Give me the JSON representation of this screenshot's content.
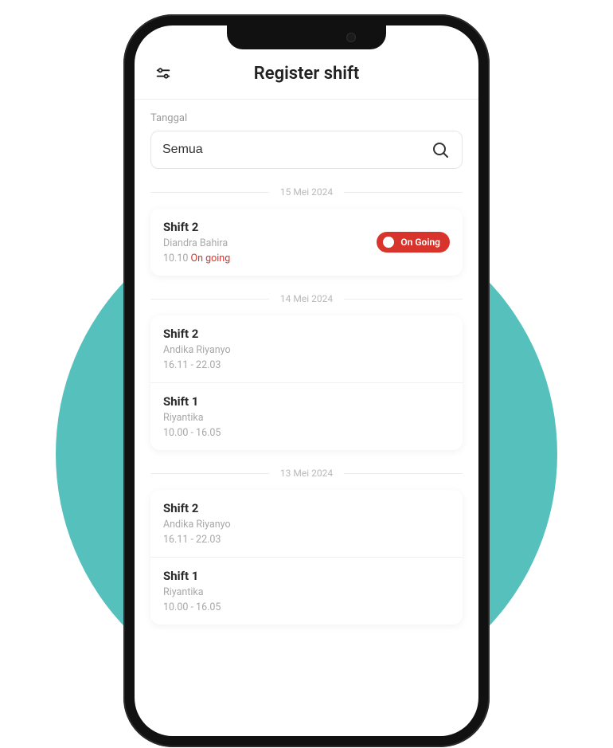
{
  "colors": {
    "accent_teal": "#55c0bc",
    "danger": "#d9342b"
  },
  "header": {
    "title": "Register shift",
    "filter_icon": "filter-icon"
  },
  "filter": {
    "label": "Tanggal",
    "value": "Semua",
    "search_icon": "search-icon"
  },
  "groups": [
    {
      "date_label": "15 Mei 2024",
      "shifts": [
        {
          "name": "Shift 2",
          "person": "Diandra Bahira",
          "time_prefix": "10.10 ",
          "ongoing_text": "On going",
          "badge_label": "On Going",
          "ongoing": true
        }
      ]
    },
    {
      "date_label": "14 Mei 2024",
      "shifts": [
        {
          "name": "Shift 2",
          "person": "Andika Riyanyo",
          "time": "16.11 - 22.03"
        },
        {
          "name": "Shift 1",
          "person": "Riyantika",
          "time": "10.00 - 16.05"
        }
      ]
    },
    {
      "date_label": "13 Mei 2024",
      "shifts": [
        {
          "name": "Shift 2",
          "person": "Andika Riyanyo",
          "time": "16.11 - 22.03"
        },
        {
          "name": "Shift 1",
          "person": "Riyantika",
          "time": "10.00 - 16.05"
        }
      ]
    }
  ]
}
